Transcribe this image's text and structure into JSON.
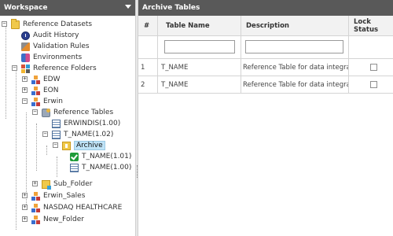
{
  "workspace": {
    "title": "Workspace",
    "tree": [
      {
        "id": "ref-datasets",
        "label": "Reference Datasets",
        "icon": "folder-icon",
        "toggle": "−"
      },
      {
        "id": "audit-history",
        "label": "Audit History",
        "icon": "audit-history-icon"
      },
      {
        "id": "validation-rules",
        "label": "Validation Rules",
        "icon": "validation-rules-icon"
      },
      {
        "id": "environments",
        "label": "Environments",
        "icon": "environments-icon"
      },
      {
        "id": "reference-folders",
        "label": "Reference Folders",
        "icon": "reference-folders-icon",
        "toggle": "−"
      },
      {
        "id": "edw",
        "label": "EDW",
        "icon": "model-icon",
        "toggle": "+"
      },
      {
        "id": "eon",
        "label": "EON",
        "icon": "model-icon",
        "toggle": "+"
      },
      {
        "id": "erwin",
        "label": "Erwin",
        "icon": "model-icon",
        "toggle": "−"
      },
      {
        "id": "reference-tables",
        "label": "Reference Tables",
        "icon": "reference-tables-icon",
        "toggle": "−"
      },
      {
        "id": "erwindis",
        "label": "ERWINDIS(1.00)",
        "icon": "table-icon"
      },
      {
        "id": "t-name-102",
        "label": "T_NAME(1.02)",
        "icon": "table-icon",
        "toggle": "−"
      },
      {
        "id": "archive",
        "label": "Archive",
        "icon": "archive-icon",
        "toggle": "−",
        "selected": true
      },
      {
        "id": "t-name-101",
        "label": "T_NAME(1.01)",
        "icon": "checked-table-icon"
      },
      {
        "id": "t-name-100",
        "label": "T_NAME(1.00)",
        "icon": "table-icon"
      },
      {
        "id": "sub-folder",
        "label": "Sub_Folder",
        "icon": "subfolder-icon",
        "toggle": "+"
      },
      {
        "id": "erwin-sales",
        "label": "Erwin_Sales",
        "icon": "model-icon",
        "toggle": "+"
      },
      {
        "id": "nasdaq",
        "label": "NASDAQ HEALTHCARE",
        "icon": "model-icon",
        "toggle": "+"
      },
      {
        "id": "new-folder",
        "label": "New_Folder",
        "icon": "model-icon",
        "toggle": "+"
      }
    ]
  },
  "archive_tables": {
    "title": "Archive Tables",
    "columns": [
      "#",
      "Table Name",
      "Description",
      "Lock Status"
    ],
    "filters": {
      "table_name": "",
      "description": ""
    },
    "rows": [
      {
        "num": "1",
        "table_name": "T_NAME",
        "description": "Reference Table for data integration",
        "locked": false
      },
      {
        "num": "2",
        "table_name": "T_NAME",
        "description": "Reference Table for data integration",
        "locked": false
      }
    ]
  }
}
